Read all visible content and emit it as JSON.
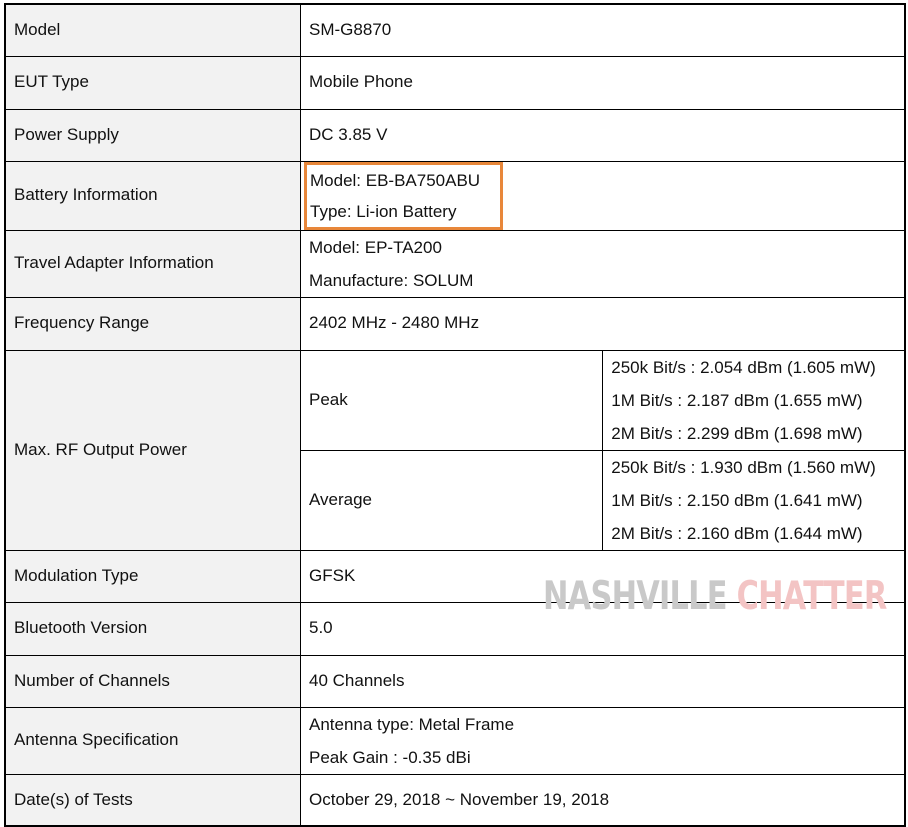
{
  "rows": {
    "model": {
      "label": "Model",
      "value": "SM-G8870"
    },
    "eut_type": {
      "label": "EUT Type",
      "value": "Mobile Phone"
    },
    "power_supply": {
      "label": "Power Supply",
      "value": "DC 3.85 V"
    },
    "battery": {
      "label": "Battery Information",
      "line1": "Model: EB-BA750ABU",
      "line2": "Type: Li-ion Battery"
    },
    "adapter": {
      "label": "Travel Adapter Information",
      "line1": "Model: EP-TA200",
      "line2": "Manufacture: SOLUM"
    },
    "frequency": {
      "label": "Frequency Range",
      "value": "2402 MHz - 2480 MHz"
    },
    "rf_power": {
      "label": "Max. RF Output Power",
      "peak": {
        "label": "Peak",
        "lines": [
          "250k Bit/s : 2.054 dBm (1.605 mW)",
          "1M Bit/s : 2.187 dBm (1.655 mW)",
          "2M Bit/s : 2.299 dBm (1.698 mW)"
        ]
      },
      "average": {
        "label": "Average",
        "lines": [
          "250k Bit/s : 1.930 dBm (1.560 mW)",
          "1M Bit/s : 2.150 dBm (1.641 mW)",
          "2M Bit/s : 2.160 dBm (1.644 mW)"
        ]
      }
    },
    "modulation": {
      "label": "Modulation Type",
      "value": "GFSK"
    },
    "bluetooth": {
      "label": "Bluetooth Version",
      "value": "5.0"
    },
    "channels": {
      "label": "Number of Channels",
      "value": "40 Channels"
    },
    "antenna": {
      "label": "Antenna Specification",
      "line1": "Antenna type: Metal Frame",
      "line2": "Peak Gain : -0.35 dBi"
    },
    "dates": {
      "label": "Date(s) of Tests",
      "value": "October 29, 2018 ~ November 19, 2018"
    }
  },
  "watermark": {
    "part1": "NASHVILLE",
    "part2": "CHATTER"
  },
  "colors": {
    "highlight": "#e8873a",
    "label_bg": "#f2f2f2"
  }
}
